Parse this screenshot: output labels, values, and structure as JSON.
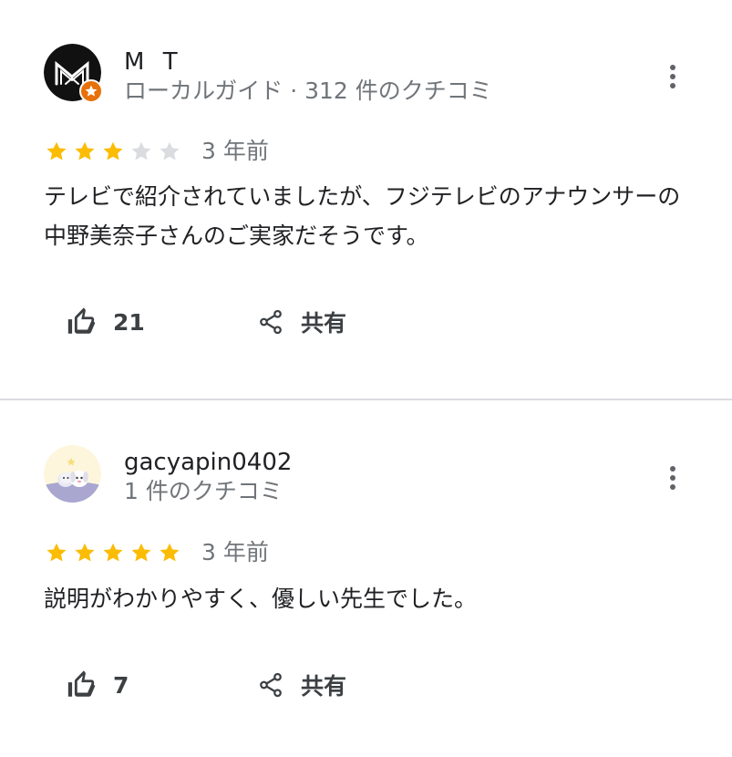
{
  "reviews": [
    {
      "author": "M T",
      "meta": "ローカルガイド · 312 件のクチコミ",
      "rating": 3,
      "max_rating": 5,
      "date": "3 年前",
      "text": "テレビで紹介されていましたが、フジテレビのアナウンサーの中野美奈子さんのご実家だそうです。",
      "likes": "21",
      "share_label": "共有",
      "avatar_icon": "mt-logo-avatar",
      "badge_icon": "local-guide-badge-icon"
    },
    {
      "author": "gacyapin0402",
      "meta": "1 件のクチコミ",
      "rating": 5,
      "max_rating": 5,
      "date": "3 年前",
      "text": "説明がわかりやすく、優しい先生でした。",
      "likes": "7",
      "share_label": "共有",
      "avatar_icon": "animal-illustration-avatar"
    }
  ],
  "colors": {
    "star_filled": "#fbbc04",
    "star_empty": "#dadce0",
    "meta_text": "#70757a",
    "badge": "#e8710a",
    "divider": "#dadce0"
  }
}
